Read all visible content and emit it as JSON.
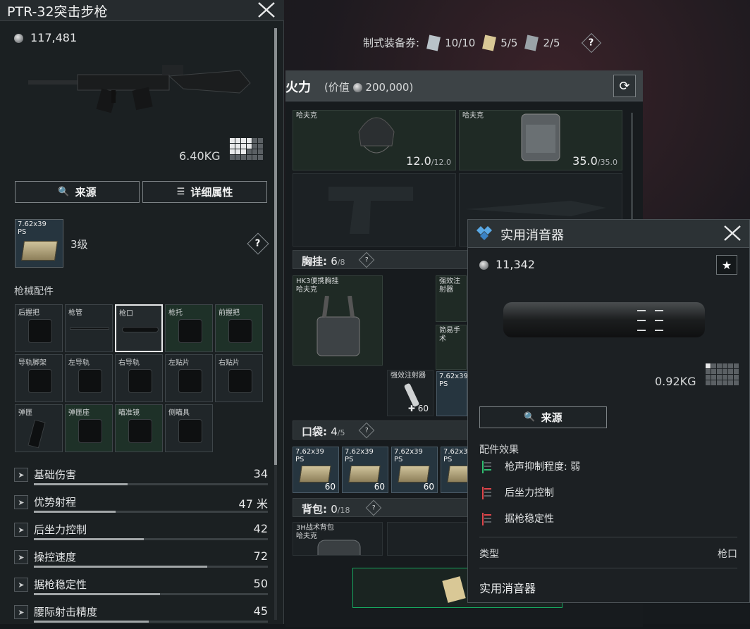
{
  "weapon": {
    "title": "PTR-32突击步枪",
    "price": "117,481",
    "weight": "6.40KG",
    "source_btn": "来源",
    "detail_btn": "详细属性",
    "ammo_tag": "7.62x39\nPS",
    "level": "3级",
    "attachments_label": "枪械配件",
    "slots": [
      "后握把",
      "枪管",
      "枪口",
      "枪托",
      "前握把",
      "导轨脚架",
      "左导轨",
      "右导轨",
      "左贴片",
      "右贴片",
      "弹匣",
      "弹匣座",
      "瞄准镜",
      "侧瞄具"
    ],
    "stats": [
      {
        "name": "基础伤害",
        "value": "34",
        "fill": 0.4,
        "icon": "gun-damage-icon"
      },
      {
        "name": "优势射程",
        "value": "47 米",
        "fill": 0.35,
        "icon": "range-icon"
      },
      {
        "name": "后坐力控制",
        "value": "42",
        "fill": 0.47,
        "icon": "recoil-icon"
      },
      {
        "name": "操控速度",
        "value": "72",
        "fill": 0.74,
        "icon": "handling-icon"
      },
      {
        "name": "据枪稳定性",
        "value": "50",
        "fill": 0.54,
        "icon": "crosshair-icon"
      },
      {
        "name": "腰际射击精度",
        "value": "45",
        "fill": 0.49,
        "icon": "hipfire-icon"
      }
    ]
  },
  "vouchers": {
    "label": "制式装备券:",
    "items": [
      {
        "value": "10/10",
        "color": "#b9c3c9"
      },
      {
        "value": "5/5",
        "color": "#d9c896"
      },
      {
        "value": "2/5",
        "color": "#9aa3a8"
      }
    ]
  },
  "loadout": {
    "title": "火力",
    "value_label": "(价值",
    "value": "200,000)",
    "helmet": {
      "tag": "哈夫克",
      "cur": "12.0",
      "max": "/12.0"
    },
    "armor": {
      "tag": "哈夫克",
      "cur": "35.0",
      "max": "/35.0"
    },
    "chest": {
      "label": "胸挂:",
      "cur": "6",
      "max": "/8",
      "item_tag": "HK3便携胸挂\n哈夫克"
    },
    "injector_tag": "强效注射器",
    "injector_count": "60",
    "kit_tag": "简易手术",
    "pocket": {
      "label": "口袋:",
      "cur": "4",
      "max": "/5",
      "ammo_tag": "7.62x39\nPS",
      "ammo_count": "60"
    },
    "backpack": {
      "label": "背包:",
      "cur": "0",
      "max": "/18",
      "item_tag": "3H战术背包\n哈夫克"
    }
  },
  "popup": {
    "title": "实用消音器",
    "price": "11,342",
    "weight": "0.92KG",
    "source_btn": "来源",
    "effects_label": "配件效果",
    "effects": [
      {
        "text": "枪声抑制程度: 弱",
        "color": "#2fbf71"
      },
      {
        "text": "后坐力控制",
        "color": "#e0454a"
      },
      {
        "text": "据枪稳定性",
        "color": "#e0454a"
      }
    ],
    "type_label": "类型",
    "type_value": "枪口",
    "name": "实用消音器"
  }
}
